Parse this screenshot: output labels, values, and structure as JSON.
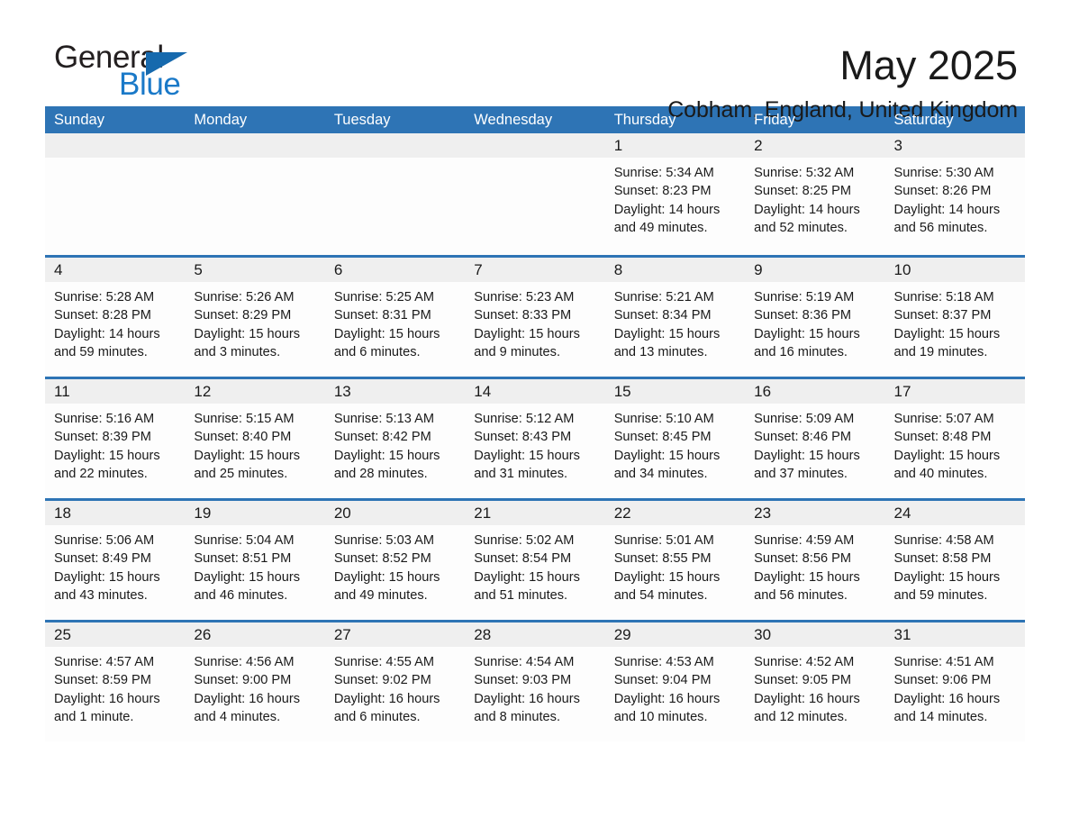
{
  "logo": {
    "word_general": "General",
    "word_blue": "Blue",
    "triangle": "triangle-mark"
  },
  "header": {
    "month_title": "May 2025",
    "location": "Cobham, England, United Kingdom"
  },
  "weekdays": [
    "Sunday",
    "Monday",
    "Tuesday",
    "Wednesday",
    "Thursday",
    "Friday",
    "Saturday"
  ],
  "colors": {
    "header_blue": "#2e74b5",
    "day_strip_gray": "#efefef",
    "logo_blue": "#1a79c8",
    "text": "#1a1a1a"
  },
  "labels": {
    "sunrise_prefix": "Sunrise: ",
    "sunset_prefix": "Sunset: ",
    "daylight_prefix": "Daylight: "
  },
  "weeks": [
    [
      {
        "day": "",
        "empty": true
      },
      {
        "day": "",
        "empty": true
      },
      {
        "day": "",
        "empty": true
      },
      {
        "day": "",
        "empty": true
      },
      {
        "day": "1",
        "sunrise": "Sunrise: 5:34 AM",
        "sunset": "Sunset: 8:23 PM",
        "daylight": "Daylight: 14 hours and 49 minutes."
      },
      {
        "day": "2",
        "sunrise": "Sunrise: 5:32 AM",
        "sunset": "Sunset: 8:25 PM",
        "daylight": "Daylight: 14 hours and 52 minutes."
      },
      {
        "day": "3",
        "sunrise": "Sunrise: 5:30 AM",
        "sunset": "Sunset: 8:26 PM",
        "daylight": "Daylight: 14 hours and 56 minutes."
      }
    ],
    [
      {
        "day": "4",
        "sunrise": "Sunrise: 5:28 AM",
        "sunset": "Sunset: 8:28 PM",
        "daylight": "Daylight: 14 hours and 59 minutes."
      },
      {
        "day": "5",
        "sunrise": "Sunrise: 5:26 AM",
        "sunset": "Sunset: 8:29 PM",
        "daylight": "Daylight: 15 hours and 3 minutes."
      },
      {
        "day": "6",
        "sunrise": "Sunrise: 5:25 AM",
        "sunset": "Sunset: 8:31 PM",
        "daylight": "Daylight: 15 hours and 6 minutes."
      },
      {
        "day": "7",
        "sunrise": "Sunrise: 5:23 AM",
        "sunset": "Sunset: 8:33 PM",
        "daylight": "Daylight: 15 hours and 9 minutes."
      },
      {
        "day": "8",
        "sunrise": "Sunrise: 5:21 AM",
        "sunset": "Sunset: 8:34 PM",
        "daylight": "Daylight: 15 hours and 13 minutes."
      },
      {
        "day": "9",
        "sunrise": "Sunrise: 5:19 AM",
        "sunset": "Sunset: 8:36 PM",
        "daylight": "Daylight: 15 hours and 16 minutes."
      },
      {
        "day": "10",
        "sunrise": "Sunrise: 5:18 AM",
        "sunset": "Sunset: 8:37 PM",
        "daylight": "Daylight: 15 hours and 19 minutes."
      }
    ],
    [
      {
        "day": "11",
        "sunrise": "Sunrise: 5:16 AM",
        "sunset": "Sunset: 8:39 PM",
        "daylight": "Daylight: 15 hours and 22 minutes."
      },
      {
        "day": "12",
        "sunrise": "Sunrise: 5:15 AM",
        "sunset": "Sunset: 8:40 PM",
        "daylight": "Daylight: 15 hours and 25 minutes."
      },
      {
        "day": "13",
        "sunrise": "Sunrise: 5:13 AM",
        "sunset": "Sunset: 8:42 PM",
        "daylight": "Daylight: 15 hours and 28 minutes."
      },
      {
        "day": "14",
        "sunrise": "Sunrise: 5:12 AM",
        "sunset": "Sunset: 8:43 PM",
        "daylight": "Daylight: 15 hours and 31 minutes."
      },
      {
        "day": "15",
        "sunrise": "Sunrise: 5:10 AM",
        "sunset": "Sunset: 8:45 PM",
        "daylight": "Daylight: 15 hours and 34 minutes."
      },
      {
        "day": "16",
        "sunrise": "Sunrise: 5:09 AM",
        "sunset": "Sunset: 8:46 PM",
        "daylight": "Daylight: 15 hours and 37 minutes."
      },
      {
        "day": "17",
        "sunrise": "Sunrise: 5:07 AM",
        "sunset": "Sunset: 8:48 PM",
        "daylight": "Daylight: 15 hours and 40 minutes."
      }
    ],
    [
      {
        "day": "18",
        "sunrise": "Sunrise: 5:06 AM",
        "sunset": "Sunset: 8:49 PM",
        "daylight": "Daylight: 15 hours and 43 minutes."
      },
      {
        "day": "19",
        "sunrise": "Sunrise: 5:04 AM",
        "sunset": "Sunset: 8:51 PM",
        "daylight": "Daylight: 15 hours and 46 minutes."
      },
      {
        "day": "20",
        "sunrise": "Sunrise: 5:03 AM",
        "sunset": "Sunset: 8:52 PM",
        "daylight": "Daylight: 15 hours and 49 minutes."
      },
      {
        "day": "21",
        "sunrise": "Sunrise: 5:02 AM",
        "sunset": "Sunset: 8:54 PM",
        "daylight": "Daylight: 15 hours and 51 minutes."
      },
      {
        "day": "22",
        "sunrise": "Sunrise: 5:01 AM",
        "sunset": "Sunset: 8:55 PM",
        "daylight": "Daylight: 15 hours and 54 minutes."
      },
      {
        "day": "23",
        "sunrise": "Sunrise: 4:59 AM",
        "sunset": "Sunset: 8:56 PM",
        "daylight": "Daylight: 15 hours and 56 minutes."
      },
      {
        "day": "24",
        "sunrise": "Sunrise: 4:58 AM",
        "sunset": "Sunset: 8:58 PM",
        "daylight": "Daylight: 15 hours and 59 minutes."
      }
    ],
    [
      {
        "day": "25",
        "sunrise": "Sunrise: 4:57 AM",
        "sunset": "Sunset: 8:59 PM",
        "daylight": "Daylight: 16 hours and 1 minute."
      },
      {
        "day": "26",
        "sunrise": "Sunrise: 4:56 AM",
        "sunset": "Sunset: 9:00 PM",
        "daylight": "Daylight: 16 hours and 4 minutes."
      },
      {
        "day": "27",
        "sunrise": "Sunrise: 4:55 AM",
        "sunset": "Sunset: 9:02 PM",
        "daylight": "Daylight: 16 hours and 6 minutes."
      },
      {
        "day": "28",
        "sunrise": "Sunrise: 4:54 AM",
        "sunset": "Sunset: 9:03 PM",
        "daylight": "Daylight: 16 hours and 8 minutes."
      },
      {
        "day": "29",
        "sunrise": "Sunrise: 4:53 AM",
        "sunset": "Sunset: 9:04 PM",
        "daylight": "Daylight: 16 hours and 10 minutes."
      },
      {
        "day": "30",
        "sunrise": "Sunrise: 4:52 AM",
        "sunset": "Sunset: 9:05 PM",
        "daylight": "Daylight: 16 hours and 12 minutes."
      },
      {
        "day": "31",
        "sunrise": "Sunrise: 4:51 AM",
        "sunset": "Sunset: 9:06 PM",
        "daylight": "Daylight: 16 hours and 14 minutes."
      }
    ]
  ]
}
